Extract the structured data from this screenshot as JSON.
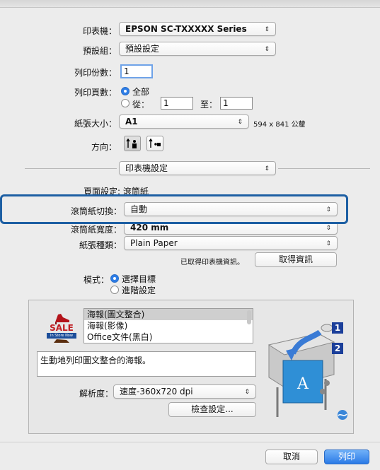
{
  "printer": {
    "label": "印表機：",
    "value": "EPSON SC-TXXXXX Series"
  },
  "presets": {
    "label": "預設組：",
    "value": "預設設定"
  },
  "copies": {
    "label": "列印份數：",
    "value": "1"
  },
  "pages": {
    "label": "列印頁數：",
    "all": "全部",
    "from": "從：",
    "from_value": "1",
    "to": "至：",
    "to_value": "1"
  },
  "paper_size": {
    "label": "紙張大小：",
    "value": "A1",
    "dimension": "594 x 841 公釐"
  },
  "orientation": {
    "label": "方向："
  },
  "section": {
    "value": "印表機設定"
  },
  "page_setup": {
    "label": "頁面設定:",
    "value": "滾筒紙"
  },
  "roll_cut": {
    "label": "滾筒紙切換：",
    "value": "自動"
  },
  "roll_width": {
    "label": "滾筒紙寬度：",
    "value": "420 mm"
  },
  "media_type": {
    "label": "紙張種類：",
    "value": "Plain Paper"
  },
  "printer_info": {
    "status": "已取得印表機資訊。",
    "button": "取得資訊"
  },
  "mode": {
    "label": "模式：",
    "option1": "選擇目標",
    "option2": "進階設定"
  },
  "targets": {
    "items": [
      "海報(圖文整合)",
      "海報(影像)",
      "Office文件(黑白)"
    ],
    "badge_sale": "SALE",
    "badge_sub": "In Store Now",
    "description": "生動地列印圖文整合的海報。"
  },
  "resolution": {
    "label": "解析度：",
    "value": "速度-360x720 dpi"
  },
  "check_button": "檢查設定...",
  "preview": {
    "num1": "1",
    "num2": "2"
  },
  "footer": {
    "cancel": "取消",
    "print": "列印"
  }
}
